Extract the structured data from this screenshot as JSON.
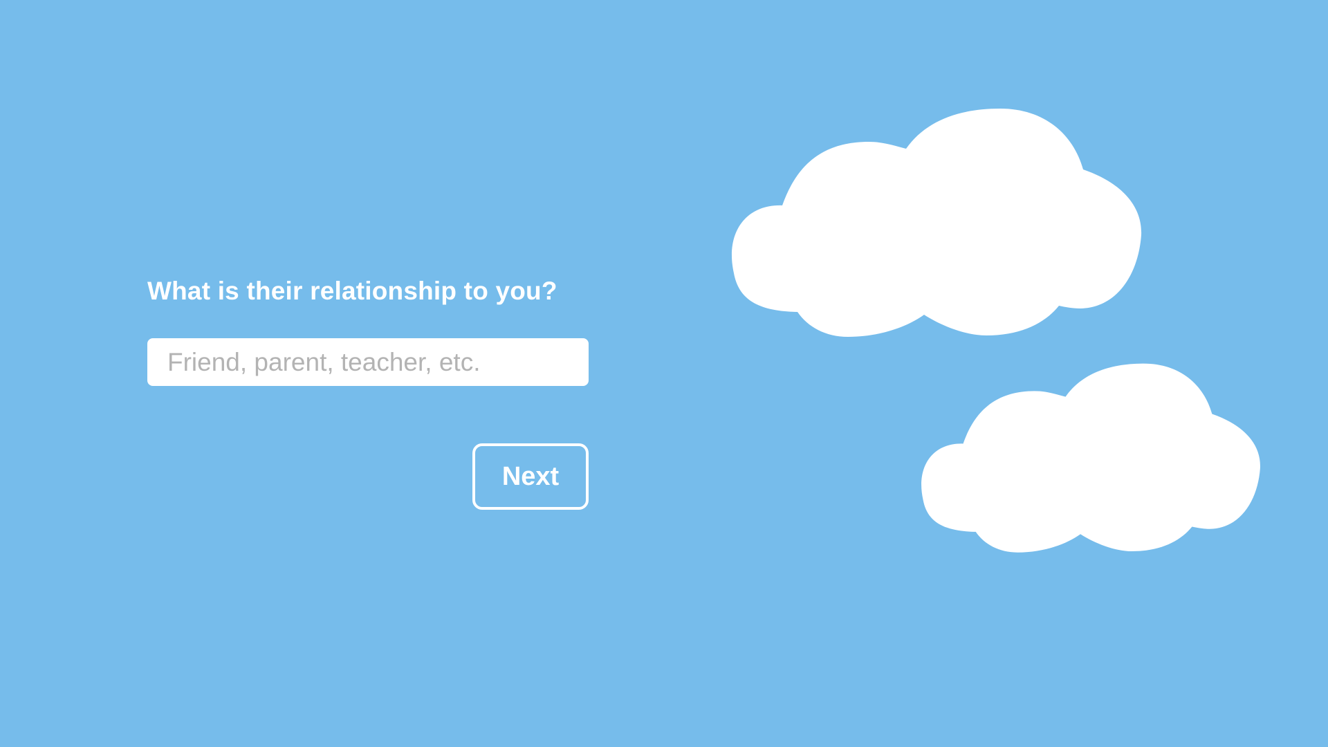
{
  "form": {
    "question": "What is their relationship to you?",
    "input_placeholder": "Friend, parent, teacher, etc.",
    "input_value": "",
    "next_label": "Next"
  },
  "colors": {
    "background": "#76bceb",
    "cloud": "#ffffff",
    "text": "#ffffff",
    "placeholder": "#b3b3b3"
  },
  "decorations": {
    "clouds": [
      "cloud-large",
      "cloud-small"
    ]
  }
}
